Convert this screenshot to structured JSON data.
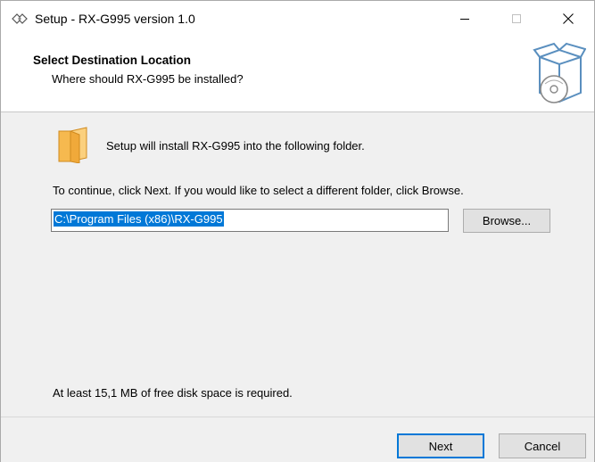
{
  "window": {
    "title": "Setup - RX-G995 version 1.0",
    "controls": {
      "minimize": "minimize-icon",
      "maximize": "maximize-icon",
      "close": "close-icon"
    }
  },
  "header": {
    "title": "Select Destination Location",
    "subtitle": "Where should RX-G995 be installed?",
    "icon": "setup-box-icon"
  },
  "main": {
    "install_text": "Setup will install RX-G995 into the following folder.",
    "continue_text": "To continue, click Next. If you would like to select a different folder, click Browse.",
    "path_value": "C:\\Program Files (x86)\\RX-G995",
    "browse_label": "Browse...",
    "space_text": "At least 15,1 MB of free disk space is required."
  },
  "footer": {
    "next_label": "Next",
    "cancel_label": "Cancel"
  },
  "colors": {
    "accent": "#0078d7",
    "folder": "#f6b94f",
    "background": "#f0f0f0"
  }
}
